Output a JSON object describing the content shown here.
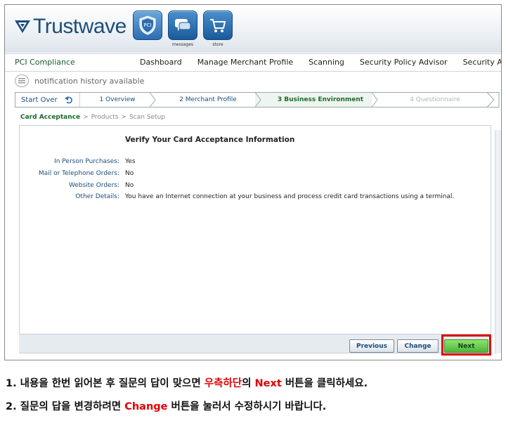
{
  "brand": {
    "logo_text": "Trustwave",
    "logo_color": "#1d4e7a"
  },
  "top_icons": [
    {
      "caption": "",
      "icon": "shield-pci-icon",
      "label": "PCI"
    },
    {
      "caption": "messages",
      "icon": "speech-bubble-icon"
    },
    {
      "caption": "store",
      "icon": "cart-icon"
    }
  ],
  "nav": {
    "section": "PCI Compliance",
    "tabs": [
      "Dashboard",
      "Manage Merchant Profile",
      "Scanning",
      "Security Policy Advisor",
      "Security Awar"
    ]
  },
  "notification": "notification history available",
  "steps": {
    "start_over": "Start Over",
    "items": [
      {
        "label": "1 Overview",
        "state": "done"
      },
      {
        "label": "2 Merchant Profile",
        "state": "done"
      },
      {
        "label": "3 Business Environment",
        "state": "active"
      },
      {
        "label": "4 Questionnaire",
        "state": "disabled"
      }
    ]
  },
  "breadcrumb": {
    "items": [
      "Card Acceptance",
      "Products",
      "Scan Setup"
    ],
    "separator": ">"
  },
  "panel": {
    "title": "Verify Your Card Acceptance Information",
    "rows": [
      {
        "label": "In Person Purchases:",
        "value": "Yes"
      },
      {
        "label": "Mail or Telephone Orders:",
        "value": "No"
      },
      {
        "label": "Website Orders:",
        "value": "No"
      },
      {
        "label": "Other Details:",
        "value": "You have an Internet connection at your business and process credit card transactions using a terminal."
      }
    ]
  },
  "buttons": {
    "previous": "Previous",
    "change": "Change",
    "next": "Next"
  },
  "instructions": {
    "line1": {
      "before": "1. 내용을 한번 읽어본 후 질문의 답이 맞으면 ",
      "red1": "우측하단",
      "mid": "의 ",
      "red2": "Next",
      "after": " 버튼을 클릭하세요."
    },
    "line2": {
      "before": "2. 질문의 답을 변경하려면 ",
      "red": "Change",
      "after": " 버튼을 눌러서 수정하시기 바랍니다."
    }
  },
  "colors": {
    "accent_green": "#1b6a2e",
    "link_blue": "#1b4d7a",
    "highlight_red": "#e00000"
  }
}
